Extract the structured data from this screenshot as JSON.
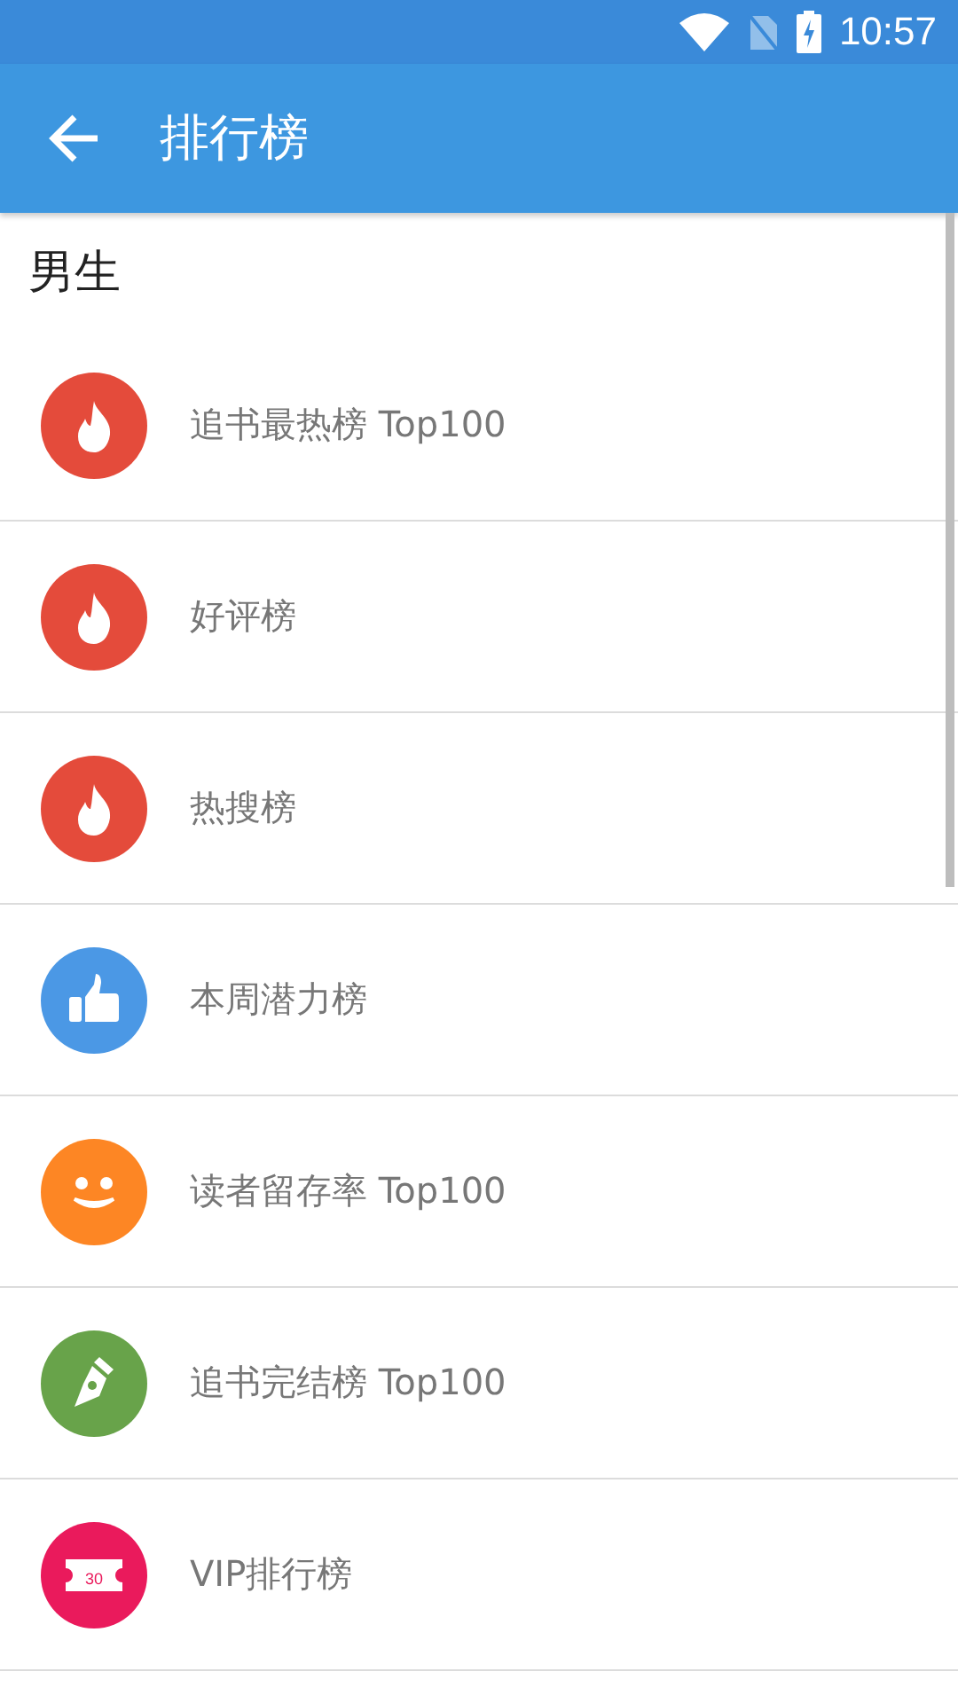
{
  "status_bar": {
    "time": "10:57"
  },
  "app_bar": {
    "title": "排行榜"
  },
  "section": {
    "title": "男生"
  },
  "items": [
    {
      "label": "追书最热榜 Top100",
      "kind": "flame",
      "color": "#e44b3b"
    },
    {
      "label": "好评榜",
      "kind": "flame",
      "color": "#e44b3b"
    },
    {
      "label": "热搜榜",
      "kind": "flame",
      "color": "#e44b3b"
    },
    {
      "label": "本周潜力榜",
      "kind": "thumb",
      "color": "#4b98e5"
    },
    {
      "label": "读者留存率 Top100",
      "kind": "smile",
      "color": "#fd8624"
    },
    {
      "label": "追书完结榜 Top100",
      "kind": "pen",
      "color": "#68a34a"
    },
    {
      "label": "VIP排行榜",
      "kind": "ticket",
      "color": "#ea1a5c",
      "icon_text": "30"
    }
  ]
}
